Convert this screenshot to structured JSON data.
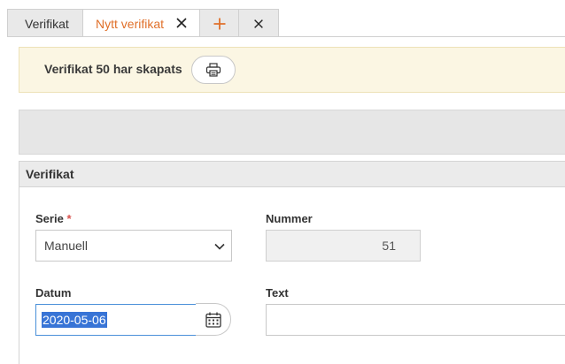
{
  "tabs": {
    "items": [
      {
        "label": "Verifikat",
        "active": false
      },
      {
        "label": "Nytt verifikat",
        "active": true,
        "closable": true
      }
    ],
    "add_icon": "plus-icon",
    "close_all_icon": "close-icon"
  },
  "banner": {
    "message": "Verifikat 50 har skapats",
    "print_icon": "printer-icon"
  },
  "panel": {
    "title": "Verifikat"
  },
  "form": {
    "serie": {
      "label": "Serie",
      "required_mark": "*",
      "value": "Manuell"
    },
    "nummer": {
      "label": "Nummer",
      "value": "51"
    },
    "datum": {
      "label": "Datum",
      "value": "2020-05-06"
    },
    "text": {
      "label": "Text",
      "value": ""
    }
  },
  "colors": {
    "accent": "#e0702a",
    "banner_bg": "#fbf6e3",
    "selection": "#3874d6",
    "required": "#d9534f"
  }
}
